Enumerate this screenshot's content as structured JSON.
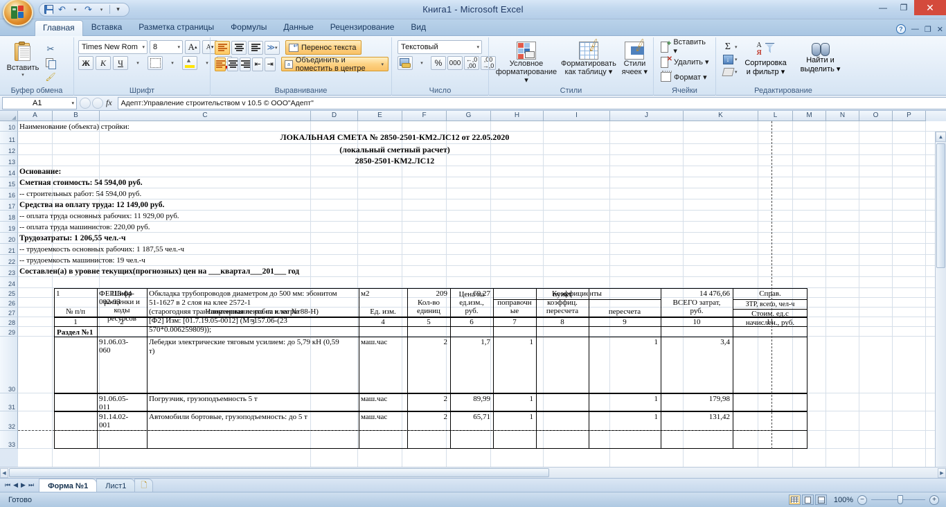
{
  "window": {
    "title": "Книга1 - Microsoft Excel",
    "minimize": "—",
    "restore": "❐",
    "close": "✕"
  },
  "quick_access": {
    "save": "save-icon",
    "undo": "↶",
    "redo": "↷",
    "customize": "▾"
  },
  "ribbon": {
    "tabs": [
      {
        "label": "Главная",
        "active": true
      },
      {
        "label": "Вставка",
        "active": false
      },
      {
        "label": "Разметка страницы",
        "active": false
      },
      {
        "label": "Формулы",
        "active": false
      },
      {
        "label": "Данные",
        "active": false
      },
      {
        "label": "Рецензирование",
        "active": false
      },
      {
        "label": "Вид",
        "active": false
      }
    ],
    "help": "?",
    "win_min": "—",
    "win_restore": "❐",
    "win_close": "✕",
    "groups": {
      "clipboard": {
        "title": "Буфер обмена",
        "paste": "Вставить",
        "paste_caret": "▾",
        "cut": "✂",
        "copy": "copy-icon",
        "format_painter": "brush-icon",
        "launcher": "⌐"
      },
      "font": {
        "title": "Шрифт",
        "font_name": "Times New Rom",
        "font_size": "8",
        "grow": "A",
        "shrink": "A",
        "bold": "Ж",
        "italic": "К",
        "underline": "Ч",
        "underline_caret": "▾",
        "borders_caret": "▾",
        "fill_caret": "▾",
        "fontcolor": "A",
        "fontcolor_caret": "▾",
        "launcher": "⌐"
      },
      "alignment": {
        "title": "Выравнивание",
        "wrap_text": "Перенос текста",
        "merge_center": "Объединить и поместить в центре",
        "merge_caret": "▾",
        "orientation_caret": "▾",
        "launcher": "⌐"
      },
      "number": {
        "title": "Число",
        "format": "Текстовый",
        "format_caret": "▾",
        "currency_caret": "▾",
        "percent": "%",
        "thousands": "000",
        "inc_dec": "→,0",
        "dec_dec": "←,0",
        "launcher": "⌐"
      },
      "styles": {
        "title": "Стили",
        "conditional": "Условное\nформатирование",
        "conditional_l1": "Условное",
        "conditional_l2": "форматирование ▾",
        "as_table_l1": "Форматировать",
        "as_table_l2": "как таблицу ▾",
        "cell_styles_l1": "Стили",
        "cell_styles_l2": "ячеек ▾"
      },
      "cells": {
        "title": "Ячейки",
        "insert": "Вставить ▾",
        "delete": "Удалить ▾",
        "format": "Формат ▾"
      },
      "editing": {
        "title": "Редактирование",
        "autosum": "Σ",
        "autosum_caret": "▾",
        "fill_caret": "▾",
        "clear_caret": "▾",
        "sort_l1": "Сортировка",
        "sort_l2": "и фильтр ▾",
        "find_l1": "Найти и",
        "find_l2": "выделить ▾"
      }
    }
  },
  "formula_bar": {
    "name_box": "A1",
    "name_caret": "▾",
    "cancel": "✕",
    "accept": "✓",
    "fx": "fx",
    "value": "Адепт:Управление строительством v 10.5 © ООО\"Адепт\""
  },
  "grid": {
    "columns": [
      "A",
      "B",
      "C",
      "D",
      "E",
      "F",
      "G",
      "H",
      "I",
      "J",
      "K",
      "L",
      "M",
      "N",
      "O",
      "P"
    ],
    "rows": [
      "10",
      "11",
      "12",
      "13",
      "14",
      "15",
      "16",
      "17",
      "18",
      "19",
      "20",
      "21",
      "22",
      "23",
      "24",
      "25",
      "26",
      "27",
      "28",
      "29",
      "30",
      "31",
      "32",
      "33"
    ]
  },
  "document": {
    "header_lines": [
      {
        "row": "10",
        "text": "Наименование (объекта) стройки:",
        "bold": false,
        "align": "left"
      },
      {
        "row": "11",
        "text": "ЛОКАЛЬНАЯ СМЕТА № 2850-2501-КМ2.ЛС12 от 22.05.2020",
        "bold": true,
        "align": "center"
      },
      {
        "row": "12",
        "text": "(локальный сметный расчет)",
        "bold": true,
        "align": "center"
      },
      {
        "row": "13",
        "text": "2850-2501-КМ2.ЛС12",
        "bold": true,
        "align": "center"
      },
      {
        "row": "14",
        "text": "Основание:",
        "bold": true,
        "align": "left"
      },
      {
        "row": "15",
        "text": "Сметная стоимость: 54 594,00 руб.",
        "bold": true,
        "align": "left"
      },
      {
        "row": "16",
        "text": "-- строительных работ: 54 594,00 руб.",
        "bold": false,
        "align": "left"
      },
      {
        "row": "17",
        "text": "Средства на оплату труда: 12 149,00 руб.",
        "bold": true,
        "align": "left"
      },
      {
        "row": "18",
        "text": "-- оплата труда основных рабочих: 11 929,00 руб.",
        "bold": false,
        "align": "left"
      },
      {
        "row": "19",
        "text": "-- оплата труда машинистов: 220,00 руб.",
        "bold": false,
        "align": "left"
      },
      {
        "row": "20",
        "text": "Трудозатраты: 1 206,55 чел.-ч",
        "bold": true,
        "align": "left"
      },
      {
        "row": "21",
        "text": "-- трудоемкость основных рабочих: 1 187,55 чел.-ч",
        "bold": false,
        "align": "left"
      },
      {
        "row": "22",
        "text": "-- трудоемкость машинистов: 19 чел.-ч",
        "bold": false,
        "align": "left"
      },
      {
        "row": "23",
        "text": "Составлен(а) в уровне текущих(прогнозных) цен на ___квартал___201___ год",
        "bold": true,
        "align": "left"
      }
    ],
    "table": {
      "header_groups": {
        "coefficients": "Коэффициенты",
        "reference": "Справ."
      },
      "headers": [
        {
          "col": "1",
          "lines": [
            "№ п/п"
          ]
        },
        {
          "col": "2",
          "lines": [
            "Шифр",
            "расценки и",
            "коды",
            "ресурсов"
          ]
        },
        {
          "col": "3",
          "lines": [
            "Наименование работ и затрат"
          ]
        },
        {
          "col": "4",
          "lines": [
            "Ед. изм."
          ]
        },
        {
          "col": "5",
          "lines": [
            "Кол-во",
            "единиц"
          ]
        },
        {
          "col": "6",
          "lines": [
            "Цена на",
            "ед.изм.,",
            "руб."
          ]
        },
        {
          "col": "7",
          "lines": [
            "поправочн",
            "ые"
          ]
        },
        {
          "col": "8",
          "lines": [
            "пункт",
            "коэффиц.",
            "пересчета"
          ]
        },
        {
          "col": "9",
          "lines": [
            "пересчета"
          ]
        },
        {
          "col": "10",
          "lines": [
            "ВСЕГО затрат,",
            "руб."
          ]
        },
        {
          "col": "11",
          "lines": [
            "ЗТР, всего, чел-ч",
            "Стоим. ед.с",
            "начислен., руб."
          ]
        }
      ],
      "numbering": [
        "1",
        "2",
        "3",
        "4",
        "5",
        "6",
        "7",
        "8",
        "9",
        "10",
        "11"
      ],
      "section_title": "Раздел №1",
      "rows": [
        {
          "row_label": "30",
          "num": "1",
          "code_lines": [
            "ФЕР13-04-",
            "002-03"
          ],
          "desc_lines": [
            "Обкладка трубопроводов диаметром до 500 мм: эбонитом",
            "51-1627 в 2 слоя на клее 2572-1",
            "(старогодняя транспортерная лента на клее № 88-Н)",
            "[Ф2] Изм: [01.7.19.05-0012] (М=157.06-(23",
            "570*0.006259809));"
          ],
          "unit": "м2",
          "qty": "209",
          "price": "69,27",
          "k_corr": "",
          "k_item": "",
          "k_recalc": "",
          "total": "14 476,66",
          "reference": ""
        },
        {
          "row_label": "31",
          "num": "",
          "code_lines": [
            "91.06.03-",
            "060"
          ],
          "desc_lines": [
            "Лебедки электрические тяговым усилием: до 5,79 кН (0,59",
            "т)"
          ],
          "unit": "маш.час",
          "qty": "2",
          "price": "1,7",
          "k_corr": "1",
          "k_item": "",
          "k_recalc": "1",
          "total": "3,4",
          "reference": ""
        },
        {
          "row_label": "32",
          "num": "",
          "code_lines": [
            "91.06.05-",
            "011"
          ],
          "desc_lines": [
            "Погрузчик, грузоподъемность 5 т"
          ],
          "unit": "маш.час",
          "qty": "2",
          "price": "89,99",
          "k_corr": "1",
          "k_item": "",
          "k_recalc": "1",
          "total": "179,98",
          "reference": ""
        },
        {
          "row_label": "33",
          "num": "",
          "code_lines": [
            "91.14.02-",
            "001"
          ],
          "desc_lines": [
            "Автомобили бортовые, грузоподъемность: до 5 т"
          ],
          "unit": "маш.час",
          "qty": "2",
          "price": "65,71",
          "k_corr": "1",
          "k_item": "",
          "k_recalc": "1",
          "total": "131,42",
          "reference": ""
        }
      ]
    }
  },
  "sheet_tabs": {
    "first": "⏮",
    "prev": "◀",
    "next": "▶",
    "last": "⏭",
    "tabs": [
      {
        "label": "Форма №1",
        "active": true
      },
      {
        "label": "Лист1",
        "active": false
      }
    ],
    "new_sheet": "new-sheet-icon"
  },
  "status_bar": {
    "state": "Готово",
    "view_normal": "normal-view-icon",
    "view_layout": "page-layout-icon",
    "view_break": "page-break-icon",
    "zoom": "100%",
    "zoom_out": "−",
    "zoom_in": "+"
  },
  "colors": {
    "accent": "#f6cf7d",
    "title_bar": "#c2d8ee",
    "close_red": "#d44a3c",
    "ribbon_text": "#17365d"
  }
}
